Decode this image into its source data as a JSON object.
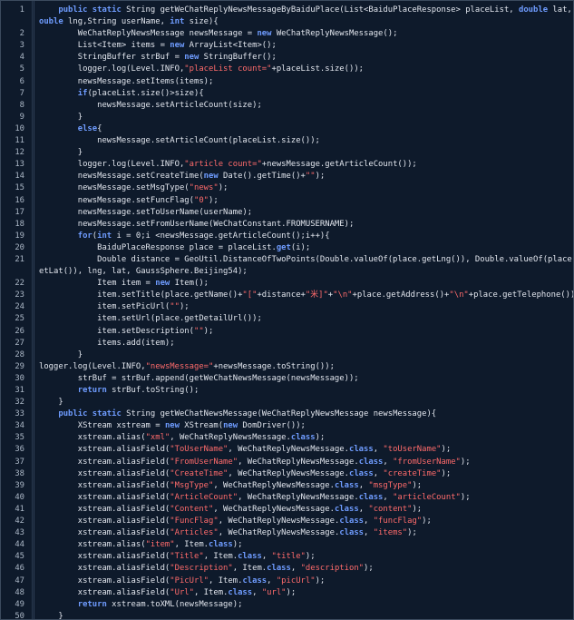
{
  "editor": {
    "rows": [
      {
        "ln": "1",
        "segs": [
          [
            "    ",
            "t"
          ],
          [
            "public",
            "kw"
          ],
          [
            " ",
            "t"
          ],
          [
            "static",
            "kw"
          ],
          [
            " String getWeChatReplyNewsMessageByBaiduPlace(List<BaiduPlaceResponse> placeList, ",
            "t"
          ],
          [
            "double",
            "kw"
          ],
          [
            " lat, ",
            "t"
          ],
          [
            "d",
            "kw"
          ]
        ]
      },
      {
        "ln": "",
        "segs": [
          [
            "ouble",
            "kw"
          ],
          [
            " lng,String userName, ",
            "t"
          ],
          [
            "int",
            "kw"
          ],
          [
            " size){",
            "t"
          ]
        ]
      },
      {
        "ln": "2",
        "segs": [
          [
            "        WeChatReplyNewsMessage newsMessage = ",
            "t"
          ],
          [
            "new",
            "kw"
          ],
          [
            " WeChatReplyNewsMessage();",
            "t"
          ]
        ]
      },
      {
        "ln": "3",
        "segs": [
          [
            "        List<Item> items = ",
            "t"
          ],
          [
            "new",
            "kw"
          ],
          [
            " ArrayList<Item>();",
            "t"
          ]
        ]
      },
      {
        "ln": "4",
        "segs": [
          [
            "        StringBuffer strBuf = ",
            "t"
          ],
          [
            "new",
            "kw"
          ],
          [
            " StringBuffer();",
            "t"
          ]
        ]
      },
      {
        "ln": "5",
        "segs": [
          [
            "        logger.log(Level.INFO,",
            "t"
          ],
          [
            "\"placeList count=\"",
            "str"
          ],
          [
            "+placeList.size());",
            "t"
          ]
        ]
      },
      {
        "ln": "6",
        "segs": [
          [
            "        newsMessage.setItems(items);",
            "t"
          ]
        ]
      },
      {
        "ln": "7",
        "segs": [
          [
            "        ",
            "t"
          ],
          [
            "if",
            "kw"
          ],
          [
            "(placeList.size()>size){",
            "t"
          ]
        ]
      },
      {
        "ln": "8",
        "segs": [
          [
            "            newsMessage.setArticleCount(size);",
            "t"
          ]
        ]
      },
      {
        "ln": "9",
        "segs": [
          [
            "        }",
            "t"
          ]
        ]
      },
      {
        "ln": "10",
        "segs": [
          [
            "        ",
            "t"
          ],
          [
            "else",
            "kw"
          ],
          [
            "{",
            "t"
          ]
        ]
      },
      {
        "ln": "11",
        "segs": [
          [
            "            newsMessage.setArticleCount(placeList.size());",
            "t"
          ]
        ]
      },
      {
        "ln": "12",
        "segs": [
          [
            "        }",
            "t"
          ]
        ]
      },
      {
        "ln": "13",
        "segs": [
          [
            "        logger.log(Level.INFO,",
            "t"
          ],
          [
            "\"article count=\"",
            "str"
          ],
          [
            "+newsMessage.getArticleCount());",
            "t"
          ]
        ]
      },
      {
        "ln": "14",
        "segs": [
          [
            "        newsMessage.setCreateTime(",
            "t"
          ],
          [
            "new",
            "kw"
          ],
          [
            " Date().getTime()+",
            "t"
          ],
          [
            "\"\"",
            "str"
          ],
          [
            ");",
            "t"
          ]
        ]
      },
      {
        "ln": "15",
        "segs": [
          [
            "        newsMessage.setMsgType(",
            "t"
          ],
          [
            "\"news\"",
            "str"
          ],
          [
            ");",
            "t"
          ]
        ]
      },
      {
        "ln": "16",
        "segs": [
          [
            "        newsMessage.setFuncFlag(",
            "t"
          ],
          [
            "\"0\"",
            "str"
          ],
          [
            ");",
            "t"
          ]
        ]
      },
      {
        "ln": "17",
        "segs": [
          [
            "        newsMessage.setToUserName(userName);",
            "t"
          ]
        ]
      },
      {
        "ln": "18",
        "segs": [
          [
            "        newsMessage.setFromUserName(WeChatConstant.FROMUSERNAME);",
            "t"
          ]
        ]
      },
      {
        "ln": "19",
        "segs": [
          [
            "        ",
            "t"
          ],
          [
            "for",
            "kw"
          ],
          [
            "(",
            "t"
          ],
          [
            "int",
            "kw"
          ],
          [
            " i = 0;i <newsMessage.getArticleCount();i++){",
            "t"
          ]
        ]
      },
      {
        "ln": "20",
        "segs": [
          [
            "            BaiduPlaceResponse place = placeList.",
            "t"
          ],
          [
            "get",
            "kw"
          ],
          [
            "(i);",
            "t"
          ]
        ]
      },
      {
        "ln": "21",
        "segs": [
          [
            "            Double distance = GeoUtil.DistanceOfTwoPoints(Double.valueOf(place.getLng()), Double.valueOf(place.g",
            "t"
          ]
        ]
      },
      {
        "ln": "",
        "segs": [
          [
            "etLat()), lng, lat, GaussSphere.Beijing54);",
            "t"
          ]
        ]
      },
      {
        "ln": "22",
        "segs": [
          [
            "            Item item = ",
            "t"
          ],
          [
            "new",
            "kw"
          ],
          [
            " Item();",
            "t"
          ]
        ]
      },
      {
        "ln": "23",
        "segs": [
          [
            "            item.setTitle(place.getName()+",
            "t"
          ],
          [
            "\"[\"",
            "str"
          ],
          [
            "+distance+",
            "t"
          ],
          [
            "\"米]\"",
            "str"
          ],
          [
            "+",
            "t"
          ],
          [
            "\"\\n\"",
            "str"
          ],
          [
            "+place.getAddress()+",
            "t"
          ],
          [
            "\"\\n\"",
            "str"
          ],
          [
            "+place.getTelephone());",
            "t"
          ]
        ]
      },
      {
        "ln": "24",
        "segs": [
          [
            "            item.setPicUrl(",
            "t"
          ],
          [
            "\"\"",
            "str"
          ],
          [
            ");",
            "t"
          ]
        ]
      },
      {
        "ln": "25",
        "segs": [
          [
            "            item.setUrl(place.getDetailUrl());",
            "t"
          ]
        ]
      },
      {
        "ln": "26",
        "segs": [
          [
            "            item.setDescription(",
            "t"
          ],
          [
            "\"\"",
            "str"
          ],
          [
            ");",
            "t"
          ]
        ]
      },
      {
        "ln": "27",
        "segs": [
          [
            "            items.add(item);",
            "t"
          ]
        ]
      },
      {
        "ln": "28",
        "segs": [
          [
            "        }",
            "t"
          ]
        ]
      },
      {
        "ln": "29",
        "segs": [
          [
            "logger.log(Level.INFO,",
            "t"
          ],
          [
            "\"newsMessage=\"",
            "str"
          ],
          [
            "+newsMessage.toString());",
            "t"
          ]
        ]
      },
      {
        "ln": "30",
        "segs": [
          [
            "        strBuf = strBuf.append(getWeChatNewsMessage(newsMessage));",
            "t"
          ]
        ]
      },
      {
        "ln": "31",
        "segs": [
          [
            "        ",
            "t"
          ],
          [
            "return",
            "kw"
          ],
          [
            " strBuf.toString();",
            "t"
          ]
        ]
      },
      {
        "ln": "32",
        "segs": [
          [
            "    }",
            "t"
          ]
        ]
      },
      {
        "ln": "33",
        "segs": [
          [
            "    ",
            "t"
          ],
          [
            "public",
            "kw"
          ],
          [
            " ",
            "t"
          ],
          [
            "static",
            "kw"
          ],
          [
            " String getWeChatNewsMessage(WeChatReplyNewsMessage newsMessage){",
            "t"
          ]
        ]
      },
      {
        "ln": "34",
        "segs": [
          [
            "        XStream xstream = ",
            "t"
          ],
          [
            "new",
            "kw"
          ],
          [
            " XStream(",
            "t"
          ],
          [
            "new",
            "kw"
          ],
          [
            " DomDriver());",
            "t"
          ]
        ]
      },
      {
        "ln": "35",
        "segs": [
          [
            "        xstream.alias(",
            "t"
          ],
          [
            "\"xml\"",
            "str"
          ],
          [
            ", WeChatReplyNewsMessage.",
            "t"
          ],
          [
            "class",
            "cls"
          ],
          [
            ");",
            "t"
          ]
        ]
      },
      {
        "ln": "36",
        "segs": [
          [
            "        xstream.aliasField(",
            "t"
          ],
          [
            "\"ToUserName\"",
            "str"
          ],
          [
            ", WeChatReplyNewsMessage.",
            "t"
          ],
          [
            "class",
            "cls"
          ],
          [
            ", ",
            "t"
          ],
          [
            "\"toUserName\"",
            "str"
          ],
          [
            ");",
            "t"
          ]
        ]
      },
      {
        "ln": "37",
        "segs": [
          [
            "        xstream.aliasField(",
            "t"
          ],
          [
            "\"FromUserName\"",
            "str"
          ],
          [
            ", WeChatReplyNewsMessage.",
            "t"
          ],
          [
            "class",
            "cls"
          ],
          [
            ", ",
            "t"
          ],
          [
            "\"fromUserName\"",
            "str"
          ],
          [
            ");",
            "t"
          ]
        ]
      },
      {
        "ln": "38",
        "segs": [
          [
            "        xstream.aliasField(",
            "t"
          ],
          [
            "\"CreateTime\"",
            "str"
          ],
          [
            ", WeChatReplyNewsMessage.",
            "t"
          ],
          [
            "class",
            "cls"
          ],
          [
            ", ",
            "t"
          ],
          [
            "\"createTime\"",
            "str"
          ],
          [
            ");",
            "t"
          ]
        ]
      },
      {
        "ln": "39",
        "segs": [
          [
            "        xstream.aliasField(",
            "t"
          ],
          [
            "\"MsgType\"",
            "str"
          ],
          [
            ", WeChatReplyNewsMessage.",
            "t"
          ],
          [
            "class",
            "cls"
          ],
          [
            ", ",
            "t"
          ],
          [
            "\"msgType\"",
            "str"
          ],
          [
            ");",
            "t"
          ]
        ]
      },
      {
        "ln": "40",
        "segs": [
          [
            "        xstream.aliasField(",
            "t"
          ],
          [
            "\"ArticleCount\"",
            "str"
          ],
          [
            ", WeChatReplyNewsMessage.",
            "t"
          ],
          [
            "class",
            "cls"
          ],
          [
            ", ",
            "t"
          ],
          [
            "\"articleCount\"",
            "str"
          ],
          [
            ");",
            "t"
          ]
        ]
      },
      {
        "ln": "41",
        "segs": [
          [
            "        xstream.aliasField(",
            "t"
          ],
          [
            "\"Content\"",
            "str"
          ],
          [
            ", WeChatReplyNewsMessage.",
            "t"
          ],
          [
            "class",
            "cls"
          ],
          [
            ", ",
            "t"
          ],
          [
            "\"content\"",
            "str"
          ],
          [
            ");",
            "t"
          ]
        ]
      },
      {
        "ln": "42",
        "segs": [
          [
            "        xstream.aliasField(",
            "t"
          ],
          [
            "\"FuncFlag\"",
            "str"
          ],
          [
            ", WeChatReplyNewsMessage.",
            "t"
          ],
          [
            "class",
            "cls"
          ],
          [
            ", ",
            "t"
          ],
          [
            "\"funcFlag\"",
            "str"
          ],
          [
            ");",
            "t"
          ]
        ]
      },
      {
        "ln": "43",
        "segs": [
          [
            "        xstream.aliasField(",
            "t"
          ],
          [
            "\"Articles\"",
            "str"
          ],
          [
            ", WeChatReplyNewsMessage.",
            "t"
          ],
          [
            "class",
            "cls"
          ],
          [
            ", ",
            "t"
          ],
          [
            "\"items\"",
            "str"
          ],
          [
            ");",
            "t"
          ]
        ]
      },
      {
        "ln": "44",
        "segs": [
          [
            "        xstream.alias(",
            "t"
          ],
          [
            "\"item\"",
            "str"
          ],
          [
            ", Item.",
            "t"
          ],
          [
            "class",
            "cls"
          ],
          [
            ");",
            "t"
          ]
        ]
      },
      {
        "ln": "45",
        "segs": [
          [
            "        xstream.aliasField(",
            "t"
          ],
          [
            "\"Title\"",
            "str"
          ],
          [
            ", Item.",
            "t"
          ],
          [
            "class",
            "cls"
          ],
          [
            ", ",
            "t"
          ],
          [
            "\"title\"",
            "str"
          ],
          [
            ");",
            "t"
          ]
        ]
      },
      {
        "ln": "46",
        "segs": [
          [
            "        xstream.aliasField(",
            "t"
          ],
          [
            "\"Description\"",
            "str"
          ],
          [
            ", Item.",
            "t"
          ],
          [
            "class",
            "cls"
          ],
          [
            ", ",
            "t"
          ],
          [
            "\"description\"",
            "str"
          ],
          [
            ");",
            "t"
          ]
        ]
      },
      {
        "ln": "47",
        "segs": [
          [
            "        xstream.aliasField(",
            "t"
          ],
          [
            "\"PicUrl\"",
            "str"
          ],
          [
            ", Item.",
            "t"
          ],
          [
            "class",
            "cls"
          ],
          [
            ", ",
            "t"
          ],
          [
            "\"picUrl\"",
            "str"
          ],
          [
            ");",
            "t"
          ]
        ]
      },
      {
        "ln": "48",
        "segs": [
          [
            "        xstream.aliasField(",
            "t"
          ],
          [
            "\"Url\"",
            "str"
          ],
          [
            ", Item.",
            "t"
          ],
          [
            "class",
            "cls"
          ],
          [
            ", ",
            "t"
          ],
          [
            "\"url\"",
            "str"
          ],
          [
            ");",
            "t"
          ]
        ]
      },
      {
        "ln": "49",
        "segs": [
          [
            "        ",
            "t"
          ],
          [
            "return",
            "kw"
          ],
          [
            " xstream.toXML(newsMessage);",
            "t"
          ]
        ]
      },
      {
        "ln": "50",
        "segs": [
          [
            "    }",
            "t"
          ]
        ]
      }
    ]
  }
}
